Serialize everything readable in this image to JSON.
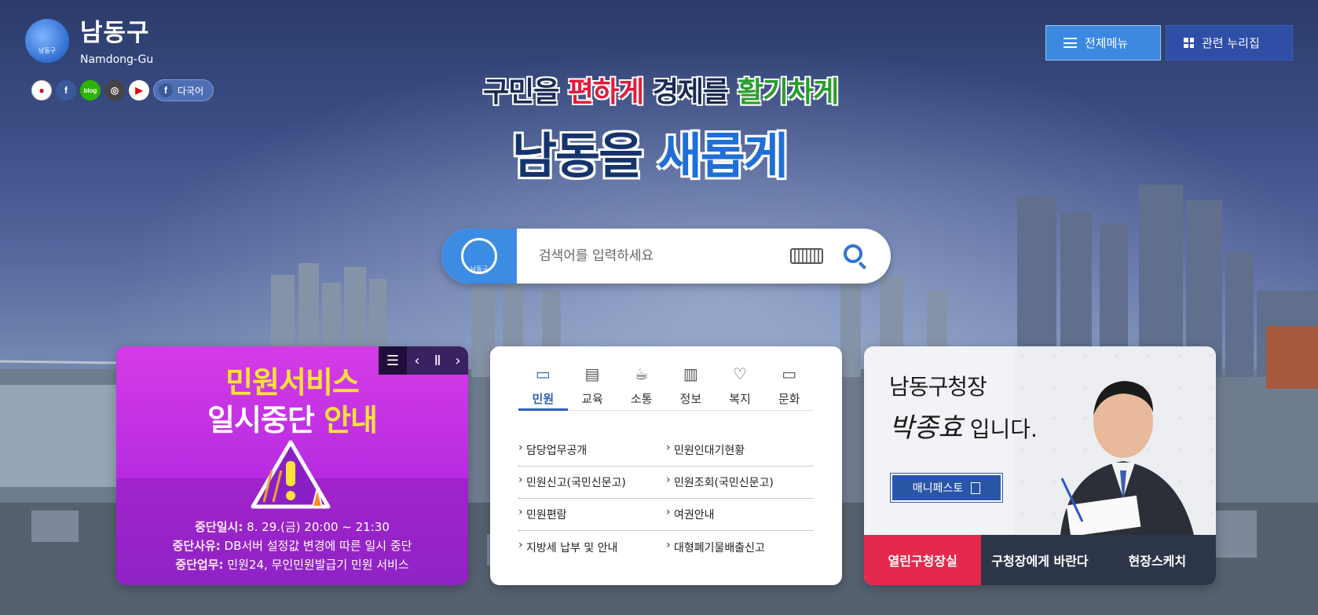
{
  "header": {
    "logo_title": "남동구",
    "logo_sub": "Namdong-Gu",
    "logo_mark_text": "남동구",
    "lang_label": "다국어",
    "menu_all": "전체메뉴",
    "menu_related": "관련 누리집"
  },
  "sns": [
    {
      "name": "flag-icon",
      "glyph": "●"
    },
    {
      "name": "facebook-icon",
      "glyph": "f"
    },
    {
      "name": "blog-icon",
      "glyph": "blog"
    },
    {
      "name": "instagram-icon",
      "glyph": "◎"
    },
    {
      "name": "youtube-icon",
      "glyph": "▶"
    }
  ],
  "slogan": {
    "line1_a": "구민을 ",
    "line1_b": "편하게",
    "line1_c": " 경제를 ",
    "line1_d": "활기차게",
    "line2_a": "남동을 ",
    "line2_b": "새롭게"
  },
  "search": {
    "placeholder": "검색어를 입력하세요",
    "logo_text": "남동구"
  },
  "notice": {
    "title_line1": "민원서비스",
    "title_line2_a": "일시중단 ",
    "title_line2_b": "안내",
    "rows": [
      {
        "label": "중단일시:",
        "value": " 8. 29.(금) 20:00 ~ 21:30"
      },
      {
        "label": "중단사유:",
        "value": " DB서버 설정값 변경에 따른 일시 중단"
      },
      {
        "label": "중단업무:",
        "value": " 민원24, 무인민원발급기 민원 서비스"
      }
    ]
  },
  "service_tabs": [
    {
      "label": "민원",
      "icon": "chat-icon",
      "glyph": "▭"
    },
    {
      "label": "교육",
      "icon": "book-icon",
      "glyph": "▤"
    },
    {
      "label": "소통",
      "icon": "cup-icon",
      "glyph": "☕"
    },
    {
      "label": "정보",
      "icon": "chart-icon",
      "glyph": "▥"
    },
    {
      "label": "복지",
      "icon": "heart-icon",
      "glyph": "♡"
    },
    {
      "label": "문화",
      "icon": "ticket-icon",
      "glyph": "▭"
    }
  ],
  "service_links": [
    [
      "담당업무공개",
      "민원인대기현황"
    ],
    [
      "민원신고(국민신문고)",
      "민원조회(국민신문고)"
    ],
    [
      "민원편람",
      "여권안내"
    ],
    [
      "지방세 납부 및 안내",
      "대형폐기물배출신고"
    ]
  ],
  "mayor": {
    "line1": "남동구청장",
    "name": "박종효",
    "line2_suffix": " 입니다.",
    "manifesto": "매니페스토",
    "tabs": [
      "열린구청장실",
      "구청장에게 바란다",
      "현장스케치"
    ]
  }
}
